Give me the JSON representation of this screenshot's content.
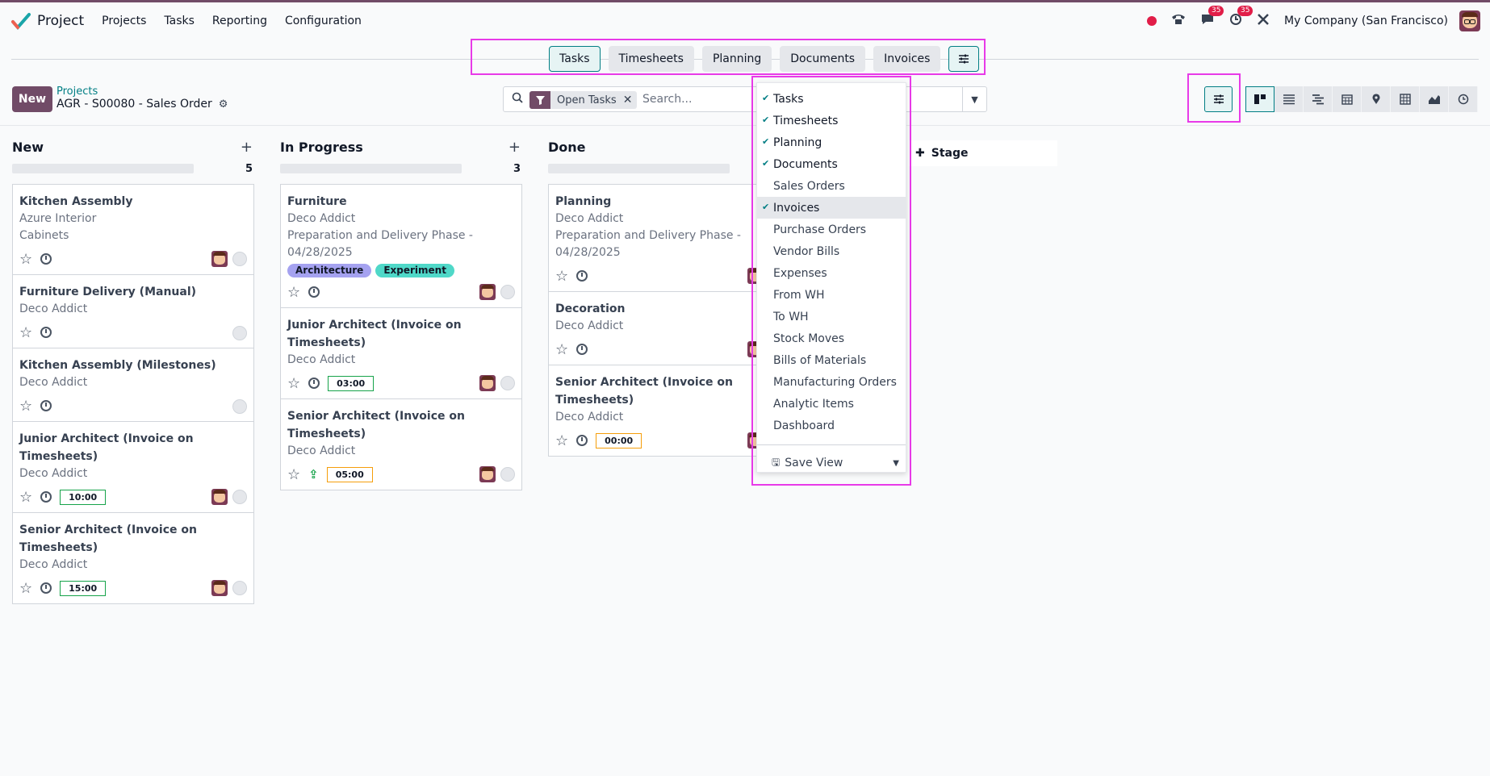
{
  "app": {
    "name": "Project",
    "brand_color": "#714b67",
    "accent": "#017e84"
  },
  "menu": [
    "Projects",
    "Tasks",
    "Reporting",
    "Configuration"
  ],
  "systray": {
    "chat_badge": "35",
    "activity_badge": "35",
    "company": "My Company (San Francisco)"
  },
  "embedded_actions": [
    "Tasks",
    "Timesheets",
    "Planning",
    "Documents",
    "Invoices"
  ],
  "control_panel": {
    "new_label": "New",
    "breadcrumb_link": "Projects",
    "breadcrumb_title": "AGR - S00080 - Sales Order"
  },
  "search": {
    "facet": "Open Tasks",
    "placeholder": "Search..."
  },
  "views": [
    "kanban",
    "list",
    "gantt",
    "calendar",
    "map",
    "pivot",
    "graph",
    "activity"
  ],
  "columns": [
    {
      "title": "New",
      "count": "5",
      "cards": [
        {
          "title": "Kitchen Assembly",
          "lines": [
            "Azure Interior",
            "Cabinets"
          ],
          "avatar": true
        },
        {
          "title": "Furniture Delivery (Manual)",
          "lines": [
            "Deco Addict"
          ],
          "avatar": false
        },
        {
          "title": "Kitchen Assembly (Milestones)",
          "lines": [
            "Deco Addict"
          ],
          "avatar": false
        },
        {
          "title": "Junior Architect (Invoice on Timesheets)",
          "lines": [
            "Deco Addict"
          ],
          "hours": "10:00",
          "hours_color": "green",
          "avatar": true
        },
        {
          "title": "Senior Architect (Invoice on Timesheets)",
          "lines": [
            "Deco Addict"
          ],
          "hours": "15:00",
          "hours_color": "green",
          "avatar": true
        }
      ]
    },
    {
      "title": "In Progress",
      "count": "3",
      "cards": [
        {
          "title": "Furniture",
          "lines": [
            "Deco Addict",
            "Preparation and Delivery Phase - 04/28/2025"
          ],
          "tags": [
            {
              "label": "Architecture",
              "color": "#a5a2f0"
            },
            {
              "label": "Experiment",
              "color": "#4fd8c8"
            }
          ],
          "avatar": true
        },
        {
          "title": "Junior Architect (Invoice on Timesheets)",
          "lines": [
            "Deco Addict"
          ],
          "hours": "03:00",
          "hours_color": "green",
          "avatar": true
        },
        {
          "title": "Senior Architect (Invoice on Timesheets)",
          "lines": [
            "Deco Addict"
          ],
          "hours": "05:00",
          "hours_color": "orange",
          "upload": true,
          "avatar": true
        }
      ]
    },
    {
      "title": "Done",
      "count": "",
      "cards": [
        {
          "title": "Planning",
          "lines": [
            "Deco Addict",
            "Preparation and Delivery Phase - 04/28/2025"
          ],
          "avatar": true
        },
        {
          "title": "Decoration",
          "lines": [
            "Deco Addict"
          ],
          "avatar": true
        },
        {
          "title": "Senior Architect (Invoice on Timesheets)",
          "lines": [
            "Deco Addict"
          ],
          "hours": "00:00",
          "hours_color": "orange",
          "avatar": true
        }
      ]
    }
  ],
  "add_stage": "Stage",
  "dropdown": {
    "items": [
      {
        "label": "Tasks",
        "checked": true
      },
      {
        "label": "Timesheets",
        "checked": true
      },
      {
        "label": "Planning",
        "checked": true
      },
      {
        "label": "Documents",
        "checked": true
      },
      {
        "label": "Sales Orders",
        "checked": false
      },
      {
        "label": "Invoices",
        "checked": true,
        "highlight": true
      },
      {
        "label": "Purchase Orders",
        "checked": false
      },
      {
        "label": "Vendor Bills",
        "checked": false
      },
      {
        "label": "Expenses",
        "checked": false
      },
      {
        "label": "From WH",
        "checked": false
      },
      {
        "label": "To WH",
        "checked": false
      },
      {
        "label": "Stock Moves",
        "checked": false
      },
      {
        "label": "Bills of Materials",
        "checked": false
      },
      {
        "label": "Manufacturing Orders",
        "checked": false
      },
      {
        "label": "Analytic Items",
        "checked": false
      },
      {
        "label": "Dashboard",
        "checked": false
      }
    ],
    "save_view": "Save View"
  }
}
